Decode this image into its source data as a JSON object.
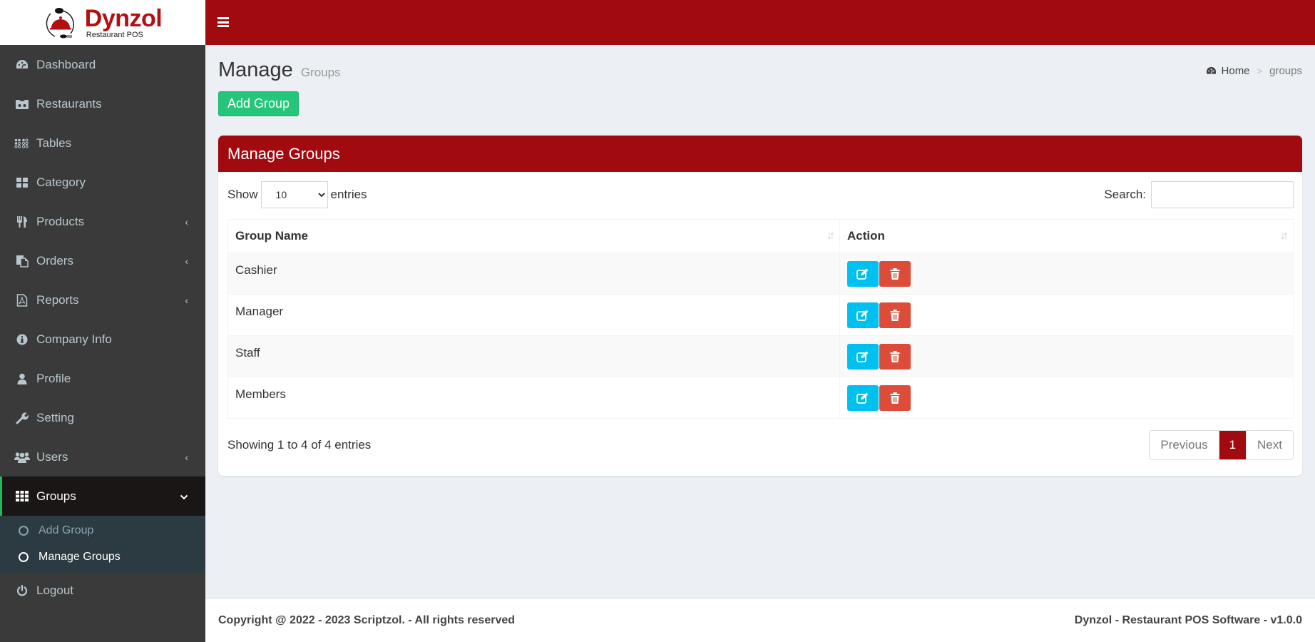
{
  "brand": {
    "name": "Dynzol",
    "tagline": "Restaurant POS",
    "accent_color": "#a10a0f",
    "success_color": "#25c57a"
  },
  "sidebar": {
    "items": [
      {
        "label": "Dashboard",
        "icon": "dashboard-icon",
        "has_children": false
      },
      {
        "label": "Restaurants",
        "icon": "restaurant-icon",
        "has_children": false
      },
      {
        "label": "Tables",
        "icon": "tables-icon",
        "has_children": false
      },
      {
        "label": "Category",
        "icon": "category-icon",
        "has_children": false
      },
      {
        "label": "Products",
        "icon": "utensils-icon",
        "has_children": true
      },
      {
        "label": "Orders",
        "icon": "orders-icon",
        "has_children": true
      },
      {
        "label": "Reports",
        "icon": "pdf-icon",
        "has_children": true
      },
      {
        "label": "Company Info",
        "icon": "info-icon",
        "has_children": false
      },
      {
        "label": "Profile",
        "icon": "user-icon",
        "has_children": false
      },
      {
        "label": "Setting",
        "icon": "wrench-icon",
        "has_children": false
      },
      {
        "label": "Users",
        "icon": "users-icon",
        "has_children": true
      },
      {
        "label": "Groups",
        "icon": "grid-icon",
        "has_children": true,
        "expanded": true,
        "active": true
      },
      {
        "label": "Logout",
        "icon": "power-icon",
        "has_children": false
      }
    ],
    "groups_submenu": [
      {
        "label": "Add Group"
      },
      {
        "label": "Manage Groups",
        "current": true
      }
    ]
  },
  "page": {
    "title": "Manage",
    "subtitle": "Groups",
    "breadcrumb": {
      "home": "Home",
      "separator": ">",
      "current": "groups"
    },
    "add_button": "Add Group"
  },
  "box": {
    "title": "Manage Groups",
    "length": {
      "show_label": "Show",
      "selected": "10",
      "entries_label": "entries"
    },
    "search": {
      "label": "Search:",
      "value": "",
      "placeholder": ""
    },
    "columns": [
      "Group Name",
      "Action"
    ],
    "rows": [
      {
        "name": "Cashier"
      },
      {
        "name": "Manager"
      },
      {
        "name": "Staff"
      },
      {
        "name": "Members"
      }
    ],
    "info": "Showing 1 to 4 of 4 entries",
    "pagination": {
      "previous": "Previous",
      "pages": [
        "1"
      ],
      "current": "1",
      "next": "Next"
    }
  },
  "footer": {
    "copyright": "Copyright @ 2022 - 2023 Scriptzol. - All rights reserved",
    "version": "Dynzol - Restaurant POS Software - v1.0.0"
  }
}
